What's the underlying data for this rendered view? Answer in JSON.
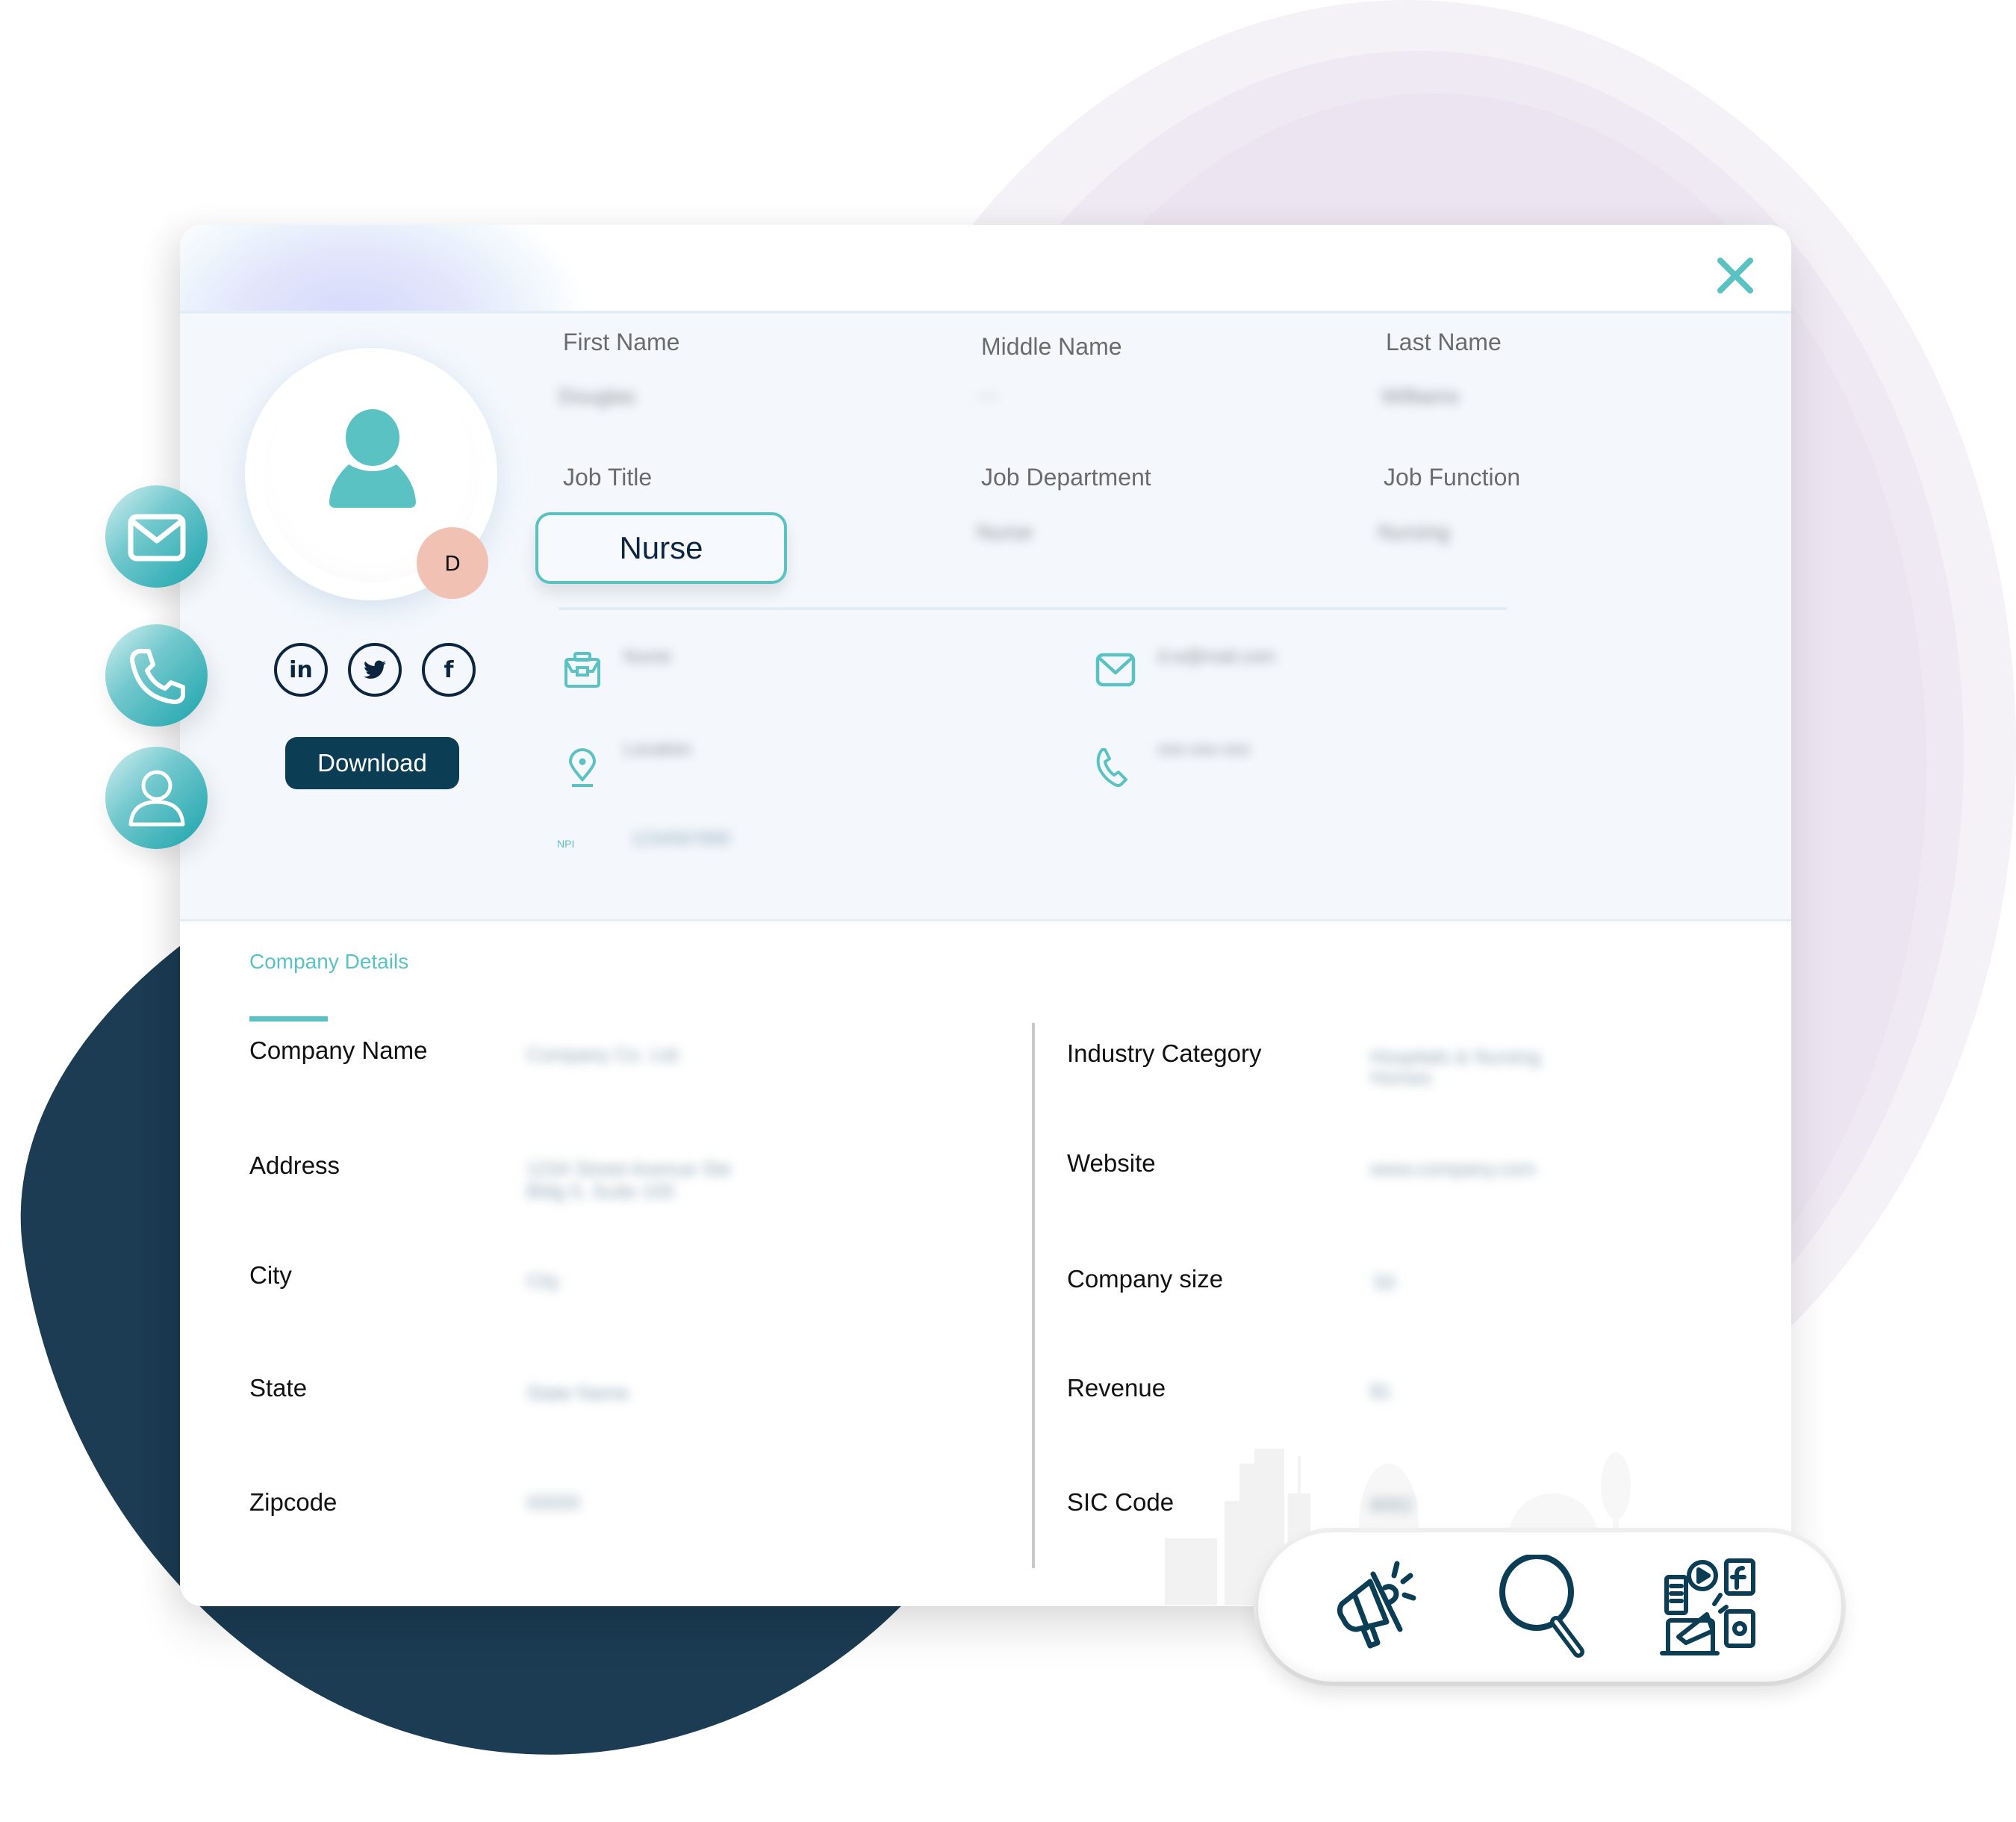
{
  "colors": {
    "accent": "#5bc2c4",
    "navy": "#0b3d55",
    "blob": "#1b3c53",
    "badge": "#f1c2b4",
    "panel": "#f4f8fd"
  },
  "header": {
    "close_icon": "close-icon"
  },
  "profile": {
    "avatar_icon": "user-icon",
    "initial": "D",
    "side_actions": [
      {
        "icon": "mail-icon"
      },
      {
        "icon": "phone-icon"
      },
      {
        "icon": "user-outline-icon"
      }
    ],
    "social": [
      {
        "name": "linkedin",
        "glyph": "in"
      },
      {
        "name": "twitter",
        "glyph": "twitter-bird"
      },
      {
        "name": "facebook",
        "glyph": "f"
      }
    ],
    "download_label": "Download"
  },
  "fields": {
    "first_name": {
      "label": "First Name",
      "value": "Douglas"
    },
    "middle_name": {
      "label": "Middle Name",
      "value": "----"
    },
    "last_name": {
      "label": "Last Name",
      "value": "Williams"
    },
    "job_title": {
      "label": "Job Title",
      "value": "Nurse"
    },
    "job_department": {
      "label": "Job Department",
      "value": "Nurse"
    },
    "job_function": {
      "label": "Job Function",
      "value": "Nursing"
    }
  },
  "contact": {
    "company": {
      "icon": "briefcase-icon",
      "value": "Nurse"
    },
    "email": {
      "icon": "mail-icon",
      "value": "d.w@mail.com"
    },
    "location": {
      "icon": "location-pin-icon",
      "value": "Location"
    },
    "phone": {
      "icon": "phone-icon",
      "value": "xxx-xxx-xxx"
    },
    "npi": {
      "label": "NPI",
      "value": "1234567890"
    }
  },
  "company": {
    "title": "Company Details",
    "left": [
      {
        "label": "Company Name",
        "value": "Company Co. Ltd."
      },
      {
        "label": "Address",
        "value": "1234 Street Avenue Ste",
        "value2": "Bldg 5, Suite 100"
      },
      {
        "label": "City",
        "value": "City"
      },
      {
        "label": "State",
        "value": "State Name"
      },
      {
        "label": "Zipcode",
        "value": "00000"
      }
    ],
    "right": [
      {
        "label": "Industry Category",
        "value": "Hospitals & Nursing",
        "value2": "Homes"
      },
      {
        "label": "Website",
        "value": "www.company.com"
      },
      {
        "label": "Company size",
        "value": "50"
      },
      {
        "label": "Revenue",
        "value": "$1"
      },
      {
        "label": "SIC Code",
        "value": "8062"
      }
    ]
  },
  "feature_bar": {
    "items": [
      {
        "icon": "megaphone-icon"
      },
      {
        "icon": "search-icon"
      },
      {
        "icon": "social-media-marketing-icon"
      }
    ]
  }
}
